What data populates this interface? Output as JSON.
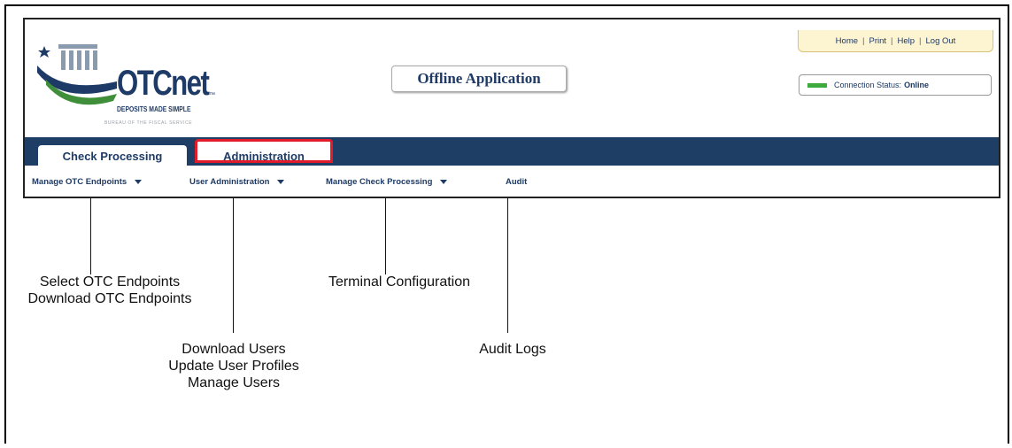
{
  "header": {
    "brand_name": "OTCnet",
    "brand_tm": "™",
    "tagline": "DEPOSITS MADE SIMPLE",
    "subtagline": "BUREAU OF THE FISCAL SERVICE",
    "app_title": "Offline Application"
  },
  "utility_links": [
    "Home",
    "Print",
    "Help",
    "Log Out"
  ],
  "connection": {
    "label": "Connection Status:",
    "value": "Online",
    "led_color": "#3caa3c"
  },
  "tabs": [
    {
      "label": "Check Processing",
      "selected": false
    },
    {
      "label": "Administration",
      "selected": true
    }
  ],
  "submenu": [
    {
      "label": "Manage OTC Endpoints",
      "has_dropdown": true
    },
    {
      "label": "User Administration",
      "has_dropdown": true
    },
    {
      "label": "Manage Check Processing",
      "has_dropdown": true
    },
    {
      "label": "Audit",
      "has_dropdown": false
    }
  ],
  "callouts": {
    "endpoints": [
      "Select OTC Endpoints",
      "Download OTC Endpoints"
    ],
    "users": [
      "Download Users",
      "Update User Profiles",
      "Manage Users"
    ],
    "check_processing": [
      "Terminal Configuration"
    ],
    "audit": [
      "Audit Logs"
    ]
  },
  "colors": {
    "nav_band": "#1f3e66",
    "brand_text": "#1e3a66",
    "highlight": "#e21b2b",
    "utility_bar": "#fdf4d2"
  }
}
